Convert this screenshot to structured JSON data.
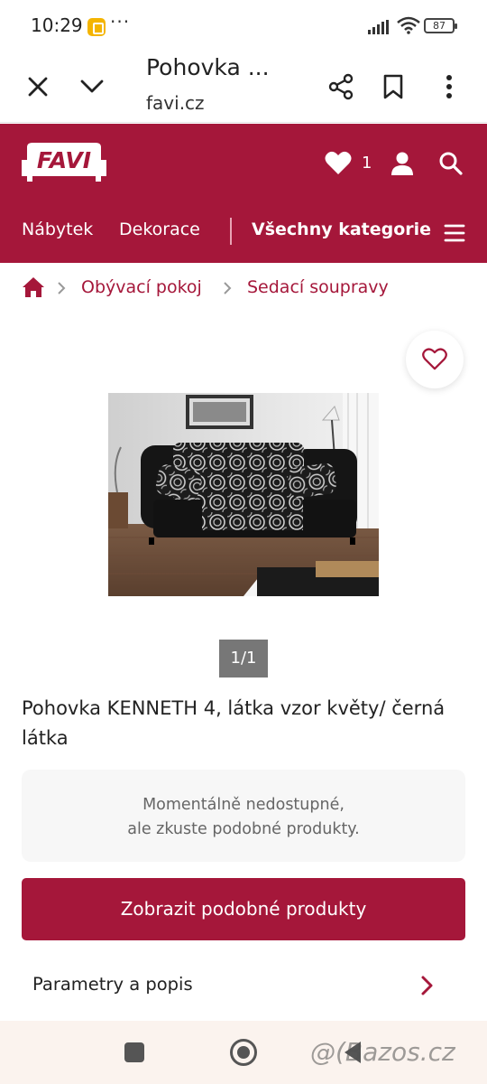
{
  "status_bar": {
    "time": "10:29",
    "dots": "···",
    "battery": "87"
  },
  "browser": {
    "title": "Pohovka ...",
    "domain": "favi.cz"
  },
  "header": {
    "logo_text": "FAVI",
    "favorites_count": "1",
    "nav": {
      "item1": "Nábytek",
      "item2": "Dekorace",
      "all_categories": "Všechny kategorie"
    }
  },
  "breadcrumb": {
    "items": [
      "Obývací pokoj",
      "Sedací soupravy"
    ]
  },
  "gallery": {
    "page_indicator": "1/1"
  },
  "product": {
    "title": "Pohovka KENNETH 4, látka vzor květy/ černá látka",
    "availability_line1": "Momentálně nedostupné,",
    "availability_line2": "ale zkuste podobné produkty.",
    "cta_label": "Zobrazit podobné produkty",
    "params_label": "Parametry a popis"
  },
  "watermark": "@(Bazos.cz",
  "colors": {
    "brand": "#a5173a",
    "background": "#ffffff",
    "panel": "#f7f7f7",
    "nav_bar": "#fbf3ee"
  },
  "icons": [
    "close-icon",
    "chevron-down-icon",
    "share-icon",
    "bookmark-icon",
    "more-vertical-icon",
    "heart-icon",
    "user-icon",
    "search-icon",
    "hamburger-menu-icon",
    "home-icon",
    "chevron-right-icon",
    "heart-outline-icon",
    "recents-icon",
    "home-button-icon",
    "back-icon"
  ]
}
